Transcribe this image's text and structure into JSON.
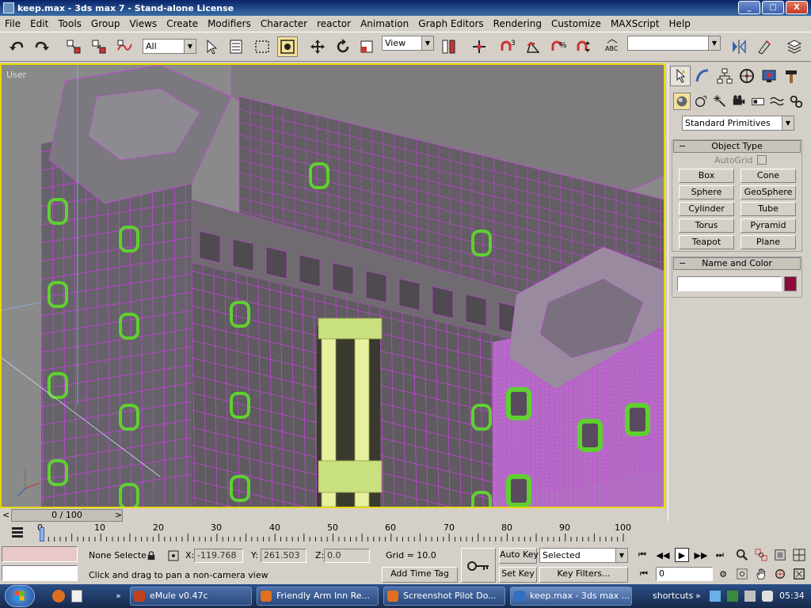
{
  "window": {
    "title": "keep.max - 3ds max 7 - Stand-alone License",
    "controls": [
      "_",
      "□",
      "X"
    ]
  },
  "menu": [
    "File",
    "Edit",
    "Tools",
    "Group",
    "Views",
    "Create",
    "Modifiers",
    "Character",
    "reactor",
    "Animation",
    "Graph Editors",
    "Rendering",
    "Customize",
    "MAXScript",
    "Help"
  ],
  "toolbar": {
    "selection_filter": "All",
    "reference_coord": "View",
    "named_selection": ""
  },
  "viewport": {
    "label": "User",
    "border_color": "#e8d800",
    "wire_color": "#d040e8",
    "window_color": "#60d030"
  },
  "command_panel": {
    "category_dropdown": "Standard Primitives",
    "object_type": {
      "title": "Object Type",
      "autogrid": "AutoGrid",
      "buttons": [
        "Box",
        "Cone",
        "Sphere",
        "GeoSphere",
        "Cylinder",
        "Tube",
        "Torus",
        "Pyramid",
        "Teapot",
        "Plane"
      ]
    },
    "name_and_color": {
      "title": "Name and Color",
      "name_value": "",
      "swatch_color": "#8b0a3a"
    }
  },
  "timeline": {
    "slider_text": "0 / 100",
    "prev": "<",
    "next": ">",
    "ticks": [
      "0",
      "10",
      "20",
      "30",
      "40",
      "50",
      "60",
      "70",
      "80",
      "90",
      "100"
    ]
  },
  "status": {
    "selection_text": "None Selecte",
    "x_label": "X:",
    "x_value": "-119.768",
    "y_label": "Y:",
    "y_value": "261.503",
    "z_label": "Z:",
    "z_value": "0.0",
    "grid": "Grid = 10.0",
    "prompt": "Click and drag to pan a non-camera view",
    "add_time_tag": "Add Time Tag",
    "auto_key": "Auto Key",
    "set_key": "Set Key",
    "key_mode": "Selected",
    "key_filters": "Key Filters...",
    "frame_value": "0"
  },
  "taskbar": {
    "items": [
      {
        "label": "eMule v0.47c",
        "icon_color": "#c04020"
      },
      {
        "label": "Friendly Arm Inn Re...",
        "icon_color": "#e07020"
      },
      {
        "label": "Screenshot Pilot Do...",
        "icon_color": "#e07020"
      },
      {
        "label": "keep.max - 3ds max ...",
        "icon_color": "#3070c0"
      }
    ],
    "shortcuts": "shortcuts",
    "chevron": "»",
    "clock": "05:34"
  }
}
